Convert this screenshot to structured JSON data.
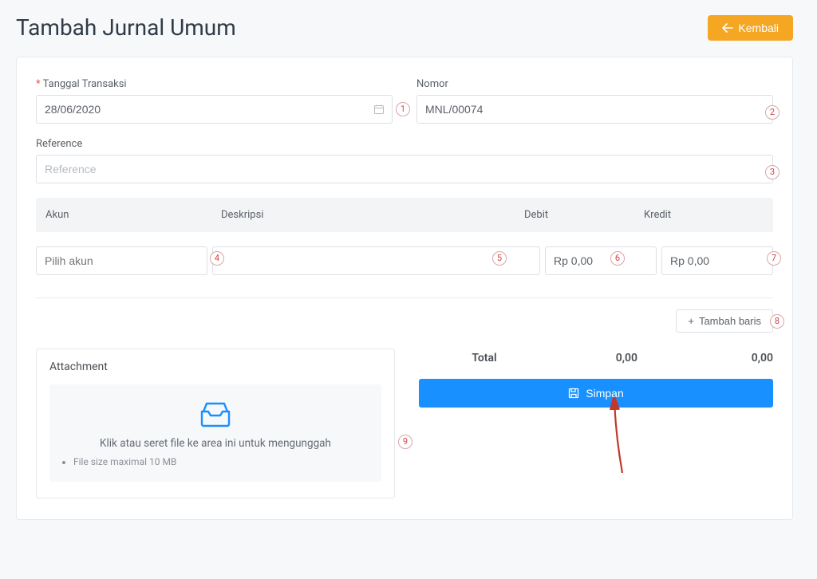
{
  "header": {
    "title": "Tambah Jurnal Umum",
    "back_label": "Kembali"
  },
  "form": {
    "tanggal_label": "Tanggal Transaksi",
    "tanggal_value": "28/06/2020",
    "nomor_label": "Nomor",
    "nomor_value": "MNL/00074",
    "reference_label": "Reference",
    "reference_placeholder": "Reference"
  },
  "columns": {
    "akun": "Akun",
    "deskripsi": "Deskripsi",
    "debit": "Debit",
    "kredit": "Kredit"
  },
  "row": {
    "akun_placeholder": "Pilih akun",
    "deskripsi_value": "",
    "debit_value": "Rp 0,00",
    "kredit_value": "Rp 0,00"
  },
  "buttons": {
    "add_row": "Tambah baris",
    "save": "Simpan"
  },
  "attachment": {
    "title": "Attachment",
    "drop_text": "Klik atau seret file ke area ini untuk mengunggah",
    "note": "File size maximal 10 MB"
  },
  "totals": {
    "label": "Total",
    "debit": "0,00",
    "kredit": "0,00"
  },
  "annotations": {
    "a1": "1",
    "a2": "2",
    "a3": "3",
    "a4": "4",
    "a5": "5",
    "a6": "6",
    "a7": "7",
    "a8": "8",
    "a9": "9"
  }
}
